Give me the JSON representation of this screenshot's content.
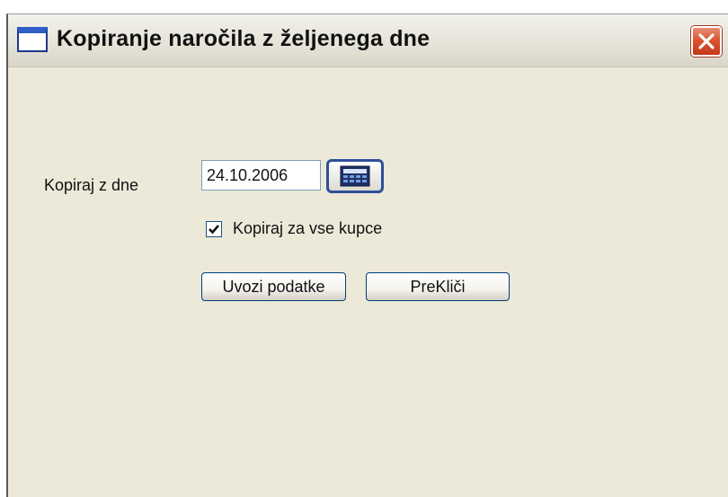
{
  "window": {
    "title": "Kopiranje naročila z željenega dne"
  },
  "form": {
    "date_label": "Kopiraj z dne",
    "date_value": "24.10.2006",
    "checkbox_label": "Kopiraj za vse kupce",
    "checkbox_checked": true
  },
  "buttons": {
    "import_label": "Uvozi podatke",
    "cancel_label": "PreKliči"
  },
  "icons": {
    "window": "window-icon",
    "close": "close-icon",
    "calendar": "calendar-icon",
    "check": "checkmark-icon"
  },
  "colors": {
    "close_button": "#d9512e",
    "window_bg": "#ece9d8",
    "button_border": "#003c74"
  }
}
